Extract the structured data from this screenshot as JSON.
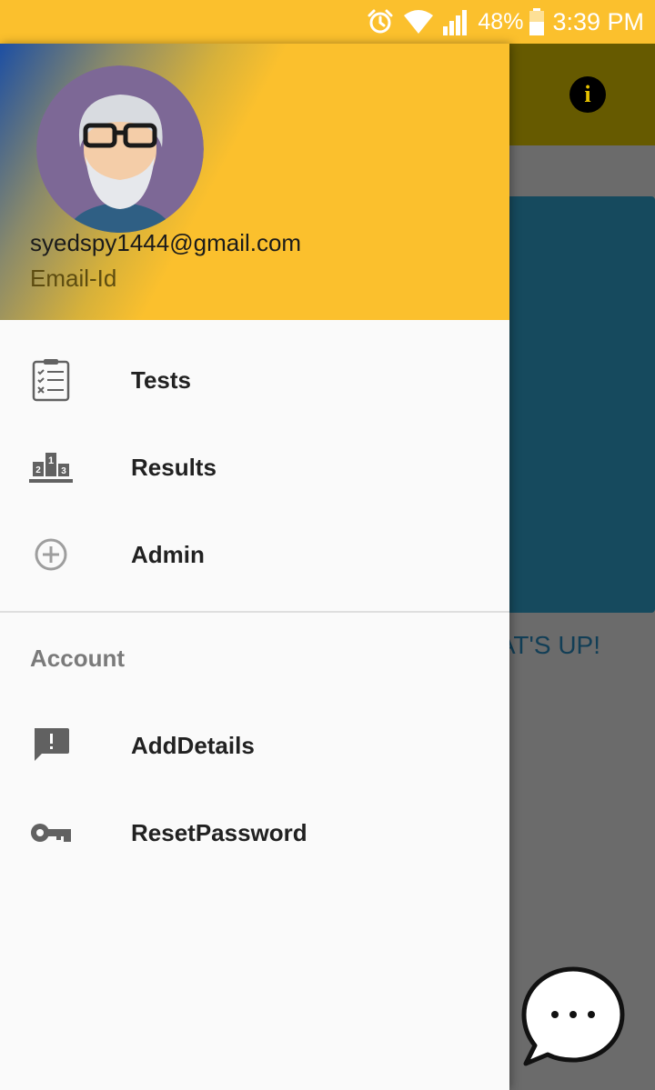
{
  "status_bar": {
    "battery": "48%",
    "time": "3:39 PM",
    "icons": [
      "alarm-icon",
      "wifi-icon",
      "signal-icon",
      "battery-icon"
    ]
  },
  "drawer": {
    "header": {
      "email": "syedspy1444@gmail.com",
      "email_label": "Email-Id"
    },
    "items": [
      {
        "label": "Tests",
        "icon": "checklist-icon"
      },
      {
        "label": "Results",
        "icon": "podium-icon"
      },
      {
        "label": "Admin",
        "icon": "add-circle-icon"
      }
    ],
    "account_section": {
      "title": "Account",
      "items": [
        {
          "label": "AddDetails",
          "icon": "feedback-icon"
        },
        {
          "label": "ResetPassword",
          "icon": "key-icon"
        }
      ]
    }
  },
  "background": {
    "partial_text": "AT'S UP!",
    "info_icon_glyph": "i"
  },
  "colors": {
    "accent": "#fbc02d",
    "toolbar_dimmed": "#665a00",
    "card_dimmed": "#164a5e"
  }
}
